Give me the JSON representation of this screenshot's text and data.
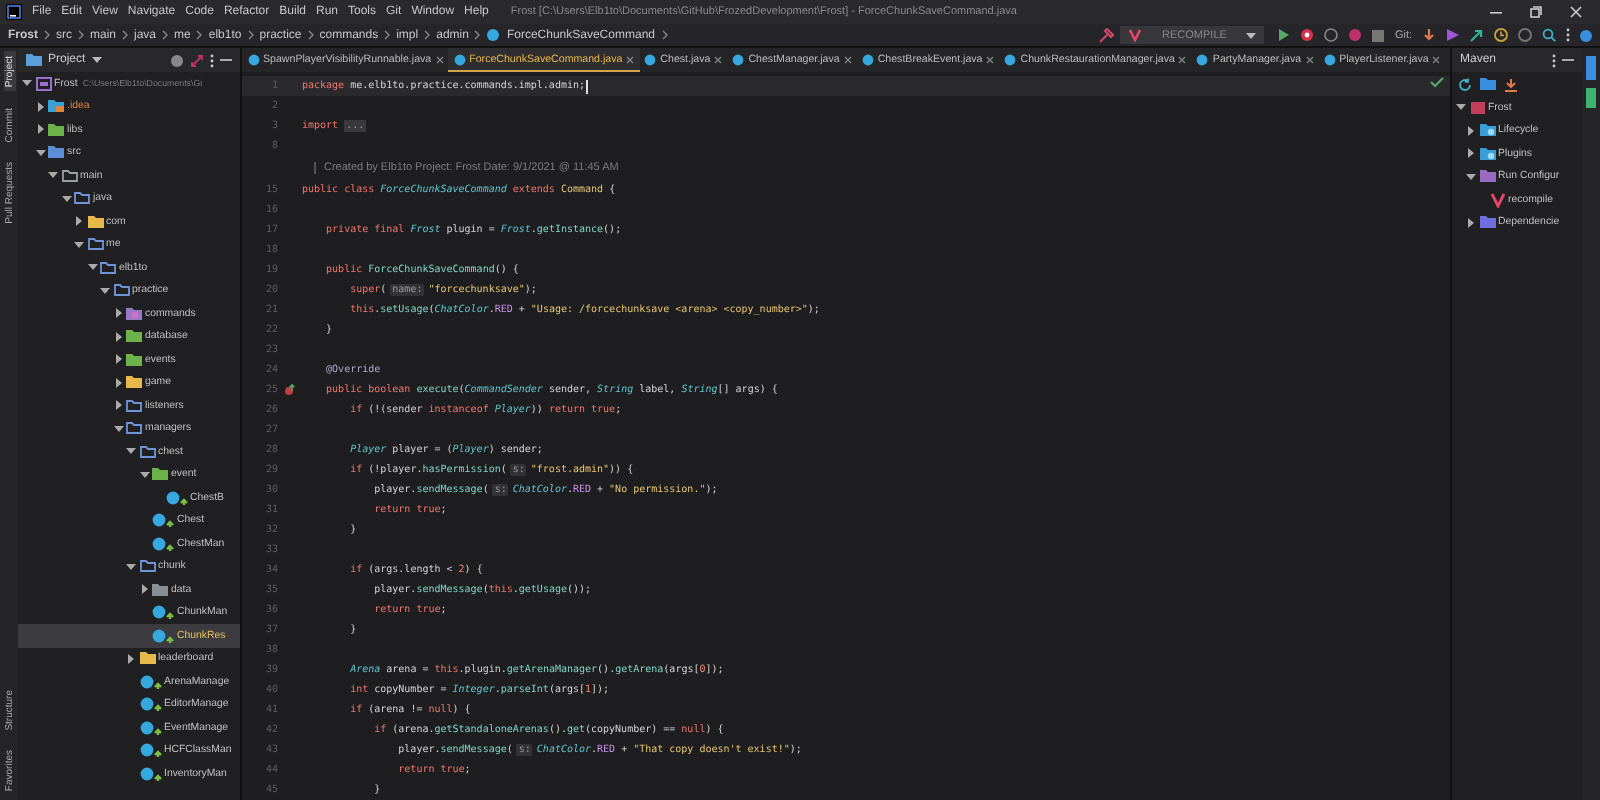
{
  "window": {
    "title": "Frost [C:\\Users\\Elb1to\\Documents\\GitHub\\FrozedDevelopment\\Frost] - ForceChunkSaveCommand.java",
    "menu": [
      "File",
      "Edit",
      "View",
      "Navigate",
      "Code",
      "Refactor",
      "Build",
      "Run",
      "Tools",
      "Git",
      "Window",
      "Help"
    ]
  },
  "breadcrumb": [
    "Frost",
    "src",
    "main",
    "java",
    "me",
    "elb1to",
    "practice",
    "commands",
    "impl",
    "admin",
    "ForceChunkSaveCommand"
  ],
  "toolbar": {
    "run_configuration": "RECOMPILE",
    "vcs_label": "Git:"
  },
  "left_strip_top": [
    {
      "label": "Project",
      "selected": true
    },
    {
      "label": "Commit",
      "selected": false
    },
    {
      "label": "Pull Requests",
      "selected": false
    }
  ],
  "left_strip_bottom": [
    {
      "label": "Structure",
      "selected": false
    },
    {
      "label": "Favorites",
      "selected": false
    }
  ],
  "project_panel": {
    "title": "Project",
    "tree": [
      {
        "label": "Frost",
        "path": "C:\\Users\\Elb1to\\Documents\\Gi",
        "kind": "module",
        "expanded": true,
        "selected": false,
        "children": [
          {
            "label": ".idea",
            "kind": "excluded",
            "expanded": false,
            "selected": false
          },
          {
            "label": "libs",
            "kind": "library",
            "expanded": false,
            "selected": false
          },
          {
            "label": "src",
            "kind": "source",
            "expanded": true,
            "selected": false,
            "children": [
              {
                "label": "main",
                "kind": "folder-plain",
                "expanded": true,
                "selected": false,
                "children": [
                  {
                    "label": "java",
                    "kind": "package",
                    "expanded": true,
                    "selected": false,
                    "children": [
                      {
                        "label": "com",
                        "kind": "folder",
                        "expanded": false,
                        "selected": false
                      },
                      {
                        "label": "me",
                        "kind": "package",
                        "expanded": true,
                        "selected": false,
                        "children": [
                          {
                            "label": "elb1to",
                            "kind": "package",
                            "expanded": true,
                            "selected": false,
                            "children": [
                              {
                                "label": "practice",
                                "kind": "package",
                                "expanded": true,
                                "selected": false,
                                "children": [
                                  {
                                    "label": "commands",
                                    "kind": "resource",
                                    "expanded": false,
                                    "selected": false
                                  },
                                  {
                                    "label": "database",
                                    "kind": "library",
                                    "expanded": false,
                                    "selected": false
                                  },
                                  {
                                    "label": "events",
                                    "kind": "library",
                                    "expanded": false,
                                    "selected": false
                                  },
                                  {
                                    "label": "game",
                                    "kind": "folder",
                                    "expanded": false,
                                    "selected": false
                                  },
                                  {
                                    "label": "listeners",
                                    "kind": "package",
                                    "expanded": false,
                                    "selected": false
                                  },
                                  {
                                    "label": "managers",
                                    "kind": "package",
                                    "expanded": true,
                                    "selected": false,
                                    "children": [
                                      {
                                        "label": "chest",
                                        "kind": "package",
                                        "expanded": true,
                                        "selected": false,
                                        "children": [
                                          {
                                            "label": "event",
                                            "kind": "library",
                                            "expanded": true,
                                            "selected": false,
                                            "children": [
                                              {
                                                "label": "ChestB",
                                                "kind": "class",
                                                "selected": false
                                              }
                                            ]
                                          },
                                          {
                                            "label": "Chest",
                                            "kind": "class",
                                            "selected": false
                                          },
                                          {
                                            "label": "ChestMan",
                                            "kind": "class",
                                            "selected": false
                                          }
                                        ]
                                      },
                                      {
                                        "label": "chunk",
                                        "kind": "package",
                                        "expanded": true,
                                        "selected": false,
                                        "children": [
                                          {
                                            "label": "data",
                                            "kind": "folder-grey",
                                            "expanded": false,
                                            "selected": false
                                          },
                                          {
                                            "label": "ChunkMan",
                                            "kind": "class",
                                            "selected": false
                                          },
                                          {
                                            "label": "ChunkRes",
                                            "kind": "class",
                                            "selected": true
                                          }
                                        ]
                                      },
                                      {
                                        "label": "leaderboard",
                                        "kind": "folder",
                                        "expanded": false,
                                        "selected": false
                                      },
                                      {
                                        "label": "ArenaManage",
                                        "kind": "class",
                                        "selected": false
                                      },
                                      {
                                        "label": "EditorManage",
                                        "kind": "class",
                                        "selected": false
                                      },
                                      {
                                        "label": "EventManage",
                                        "kind": "class",
                                        "selected": false
                                      },
                                      {
                                        "label": "HCFClassMan",
                                        "kind": "class",
                                        "selected": false
                                      },
                                      {
                                        "label": "InventoryMan",
                                        "kind": "class",
                                        "selected": false
                                      }
                                    ]
                                  }
                                ]
                              }
                            ]
                          }
                        ]
                      }
                    ]
                  }
                ]
              }
            ]
          }
        ]
      }
    ]
  },
  "editor": {
    "tabs": [
      {
        "label": "SpawnPlayerVisibilityRunnable.java",
        "selected": false
      },
      {
        "label": "ForceChunkSaveCommand.java",
        "selected": true
      },
      {
        "label": "Chest.java",
        "selected": false
      },
      {
        "label": "ChestManager.java",
        "selected": false
      },
      {
        "label": "ChestBreakEvent.java",
        "selected": false
      },
      {
        "label": "ChunkRestaurationManager.java",
        "selected": false
      },
      {
        "label": "PartyManager.java",
        "selected": false
      },
      {
        "label": "PlayerListener.java",
        "selected": false
      }
    ],
    "lines": [
      {
        "kind": "code",
        "number": "1",
        "current": true,
        "tokens": [
          {
            "kind": "keyword",
            "text": "package "
          },
          {
            "kind": "plain",
            "text": "me.elb1to.practice.commands.impl.admin;"
          }
        ]
      },
      {
        "kind": "code",
        "number": "2",
        "current": false
      },
      {
        "kind": "code",
        "number": "3",
        "current": false,
        "tokens": [
          {
            "kind": "keyword",
            "text": "import "
          },
          {
            "kind": "fold",
            "text": "..."
          }
        ]
      },
      {
        "kind": "code",
        "number": "8",
        "current": false
      },
      {
        "kind": "doc",
        "current": false,
        "tokens": [
          {
            "kind": "doc",
            "text": "Created by Elb1to Project: Frost Date: 9/1/2021 @ 11:45 AM"
          }
        ]
      },
      {
        "kind": "code",
        "number": "15",
        "current": false,
        "tokens": [
          {
            "kind": "keyword",
            "text": "public class "
          },
          {
            "kind": "type",
            "text": "ForceChunkSaveCommand "
          },
          {
            "kind": "keyword",
            "text": "extends "
          },
          {
            "kind": "super",
            "text": "Command "
          },
          {
            "kind": "plain",
            "text": "{"
          }
        ]
      },
      {
        "kind": "code",
        "number": "16",
        "current": false
      },
      {
        "kind": "code",
        "number": "17",
        "current": false,
        "tokens": [
          {
            "kind": "keyword",
            "text": "    private final "
          },
          {
            "kind": "type",
            "text": "Frost "
          },
          {
            "kind": "plain",
            "text": "plugin = "
          },
          {
            "kind": "type",
            "text": "Frost"
          },
          {
            "kind": "plain",
            "text": "."
          },
          {
            "kind": "method",
            "text": "getInstance"
          },
          {
            "kind": "plain",
            "text": "();"
          }
        ]
      },
      {
        "kind": "code",
        "number": "18",
        "current": false
      },
      {
        "kind": "code",
        "number": "19",
        "current": false,
        "tokens": [
          {
            "kind": "keyword",
            "text": "    public "
          },
          {
            "kind": "method",
            "text": "ForceChunkSaveCommand"
          },
          {
            "kind": "plain",
            "text": "() {"
          }
        ]
      },
      {
        "kind": "code",
        "number": "20",
        "current": false,
        "tokens": [
          {
            "kind": "keyword",
            "text": "        super"
          },
          {
            "kind": "plain",
            "text": "("
          },
          {
            "kind": "hint",
            "text": "name:"
          },
          {
            "kind": "string",
            "text": "\"forcechunksave\""
          },
          {
            "kind": "plain",
            "text": ");"
          }
        ]
      },
      {
        "kind": "code",
        "number": "21",
        "current": false,
        "tokens": [
          {
            "kind": "keyword",
            "text": "        this"
          },
          {
            "kind": "plain",
            "text": "."
          },
          {
            "kind": "method",
            "text": "setUsage"
          },
          {
            "kind": "plain",
            "text": "("
          },
          {
            "kind": "type",
            "text": "ChatColor"
          },
          {
            "kind": "plain",
            "text": "."
          },
          {
            "kind": "field",
            "text": "RED"
          },
          {
            "kind": "plain",
            "text": " + "
          },
          {
            "kind": "string",
            "text": "\"Usage: /forcechunksave <arena> <copy_number>\""
          },
          {
            "kind": "plain",
            "text": ");"
          }
        ]
      },
      {
        "kind": "code",
        "number": "22",
        "current": false,
        "tokens": [
          {
            "kind": "plain",
            "text": "    }"
          }
        ]
      },
      {
        "kind": "code",
        "number": "23",
        "current": false
      },
      {
        "kind": "code",
        "number": "24",
        "current": false,
        "tokens": [
          {
            "kind": "annotation",
            "text": "    @Override"
          }
        ]
      },
      {
        "kind": "override",
        "number": "25",
        "current": false,
        "tokens": [
          {
            "kind": "keyword",
            "text": "    public boolean "
          },
          {
            "kind": "method",
            "text": "execute"
          },
          {
            "kind": "plain",
            "text": "("
          },
          {
            "kind": "type",
            "text": "CommandSender "
          },
          {
            "kind": "plain",
            "text": "sender, "
          },
          {
            "kind": "type",
            "text": "String "
          },
          {
            "kind": "plain",
            "text": "label, "
          },
          {
            "kind": "type",
            "text": "String"
          },
          {
            "kind": "plain",
            "text": "[] args) {"
          }
        ]
      },
      {
        "kind": "code",
        "number": "26",
        "current": false,
        "tokens": [
          {
            "kind": "keyword",
            "text": "        if "
          },
          {
            "kind": "plain",
            "text": "(!(sender "
          },
          {
            "kind": "keyword",
            "text": "instanceof "
          },
          {
            "kind": "type",
            "text": "Player"
          },
          {
            "kind": "plain",
            "text": ")) "
          },
          {
            "kind": "keyword",
            "text": "return true"
          },
          {
            "kind": "plain",
            "text": ";"
          }
        ]
      },
      {
        "kind": "code",
        "number": "27",
        "current": false
      },
      {
        "kind": "code",
        "number": "28",
        "current": false,
        "tokens": [
          {
            "kind": "type",
            "text": "        Player "
          },
          {
            "kind": "plain",
            "text": "player = ("
          },
          {
            "kind": "type",
            "text": "Player"
          },
          {
            "kind": "plain",
            "text": ") sender;"
          }
        ]
      },
      {
        "kind": "code",
        "number": "29",
        "current": false,
        "tokens": [
          {
            "kind": "keyword",
            "text": "        if "
          },
          {
            "kind": "plain",
            "text": "(!player."
          },
          {
            "kind": "method",
            "text": "hasPermission"
          },
          {
            "kind": "plain",
            "text": "("
          },
          {
            "kind": "hint",
            "text": "s:"
          },
          {
            "kind": "string",
            "text": "\"frost.admin\""
          },
          {
            "kind": "plain",
            "text": ")) {"
          }
        ]
      },
      {
        "kind": "code",
        "number": "30",
        "current": false,
        "tokens": [
          {
            "kind": "plain",
            "text": "            player."
          },
          {
            "kind": "method",
            "text": "sendMessage"
          },
          {
            "kind": "plain",
            "text": "("
          },
          {
            "kind": "hint",
            "text": "s:"
          },
          {
            "kind": "type",
            "text": "ChatColor"
          },
          {
            "kind": "plain",
            "text": "."
          },
          {
            "kind": "field",
            "text": "RED"
          },
          {
            "kind": "plain",
            "text": " + "
          },
          {
            "kind": "string",
            "text": "\"No permission.\""
          },
          {
            "kind": "plain",
            "text": ");"
          }
        ]
      },
      {
        "kind": "code",
        "number": "31",
        "current": false,
        "tokens": [
          {
            "kind": "keyword",
            "text": "            return true"
          },
          {
            "kind": "plain",
            "text": ";"
          }
        ]
      },
      {
        "kind": "code",
        "number": "32",
        "current": false,
        "tokens": [
          {
            "kind": "plain",
            "text": "        }"
          }
        ]
      },
      {
        "kind": "code",
        "number": "33",
        "current": false
      },
      {
        "kind": "code",
        "number": "34",
        "current": false,
        "tokens": [
          {
            "kind": "keyword",
            "text": "        if "
          },
          {
            "kind": "plain",
            "text": "(args.length < "
          },
          {
            "kind": "number",
            "text": "2"
          },
          {
            "kind": "plain",
            "text": ") {"
          }
        ]
      },
      {
        "kind": "code",
        "number": "35",
        "current": false,
        "tokens": [
          {
            "kind": "plain",
            "text": "            player."
          },
          {
            "kind": "method",
            "text": "sendMessage"
          },
          {
            "kind": "plain",
            "text": "("
          },
          {
            "kind": "keyword",
            "text": "this"
          },
          {
            "kind": "plain",
            "text": "."
          },
          {
            "kind": "method",
            "text": "getUsage"
          },
          {
            "kind": "plain",
            "text": "());"
          }
        ]
      },
      {
        "kind": "code",
        "number": "36",
        "current": false,
        "tokens": [
          {
            "kind": "keyword",
            "text": "            return true"
          },
          {
            "kind": "plain",
            "text": ";"
          }
        ]
      },
      {
        "kind": "code",
        "number": "37",
        "current": false,
        "tokens": [
          {
            "kind": "plain",
            "text": "        }"
          }
        ]
      },
      {
        "kind": "code",
        "number": "38",
        "current": false
      },
      {
        "kind": "code",
        "number": "39",
        "current": false,
        "tokens": [
          {
            "kind": "type",
            "text": "        Arena "
          },
          {
            "kind": "plain",
            "text": "arena = "
          },
          {
            "kind": "keyword",
            "text": "this"
          },
          {
            "kind": "plain",
            "text": ".plugin."
          },
          {
            "kind": "method",
            "text": "getArenaManager"
          },
          {
            "kind": "plain",
            "text": "()."
          },
          {
            "kind": "method",
            "text": "getArena"
          },
          {
            "kind": "plain",
            "text": "(args["
          },
          {
            "kind": "number",
            "text": "0"
          },
          {
            "kind": "plain",
            "text": "]);"
          }
        ]
      },
      {
        "kind": "code",
        "number": "40",
        "current": false,
        "tokens": [
          {
            "kind": "keyword",
            "text": "        int "
          },
          {
            "kind": "plain",
            "text": "copyNumber = "
          },
          {
            "kind": "type",
            "text": "Integer"
          },
          {
            "kind": "plain",
            "text": "."
          },
          {
            "kind": "method",
            "text": "parseInt"
          },
          {
            "kind": "plain",
            "text": "(args["
          },
          {
            "kind": "number",
            "text": "1"
          },
          {
            "kind": "plain",
            "text": "]);"
          }
        ]
      },
      {
        "kind": "code",
        "number": "41",
        "current": false,
        "tokens": [
          {
            "kind": "keyword",
            "text": "        if "
          },
          {
            "kind": "plain",
            "text": "(arena != "
          },
          {
            "kind": "keyword",
            "text": "null"
          },
          {
            "kind": "plain",
            "text": ") {"
          }
        ]
      },
      {
        "kind": "code",
        "number": "42",
        "current": false,
        "tokens": [
          {
            "kind": "keyword",
            "text": "            if "
          },
          {
            "kind": "plain",
            "text": "(arena."
          },
          {
            "kind": "method",
            "text": "getStandaloneArenas"
          },
          {
            "kind": "plain",
            "text": "()."
          },
          {
            "kind": "method",
            "text": "get"
          },
          {
            "kind": "plain",
            "text": "(copyNumber) == "
          },
          {
            "kind": "keyword",
            "text": "null"
          },
          {
            "kind": "plain",
            "text": ") {"
          }
        ]
      },
      {
        "kind": "code",
        "number": "43",
        "current": false,
        "tokens": [
          {
            "kind": "plain",
            "text": "                player."
          },
          {
            "kind": "method",
            "text": "sendMessage"
          },
          {
            "kind": "plain",
            "text": "("
          },
          {
            "kind": "hint",
            "text": "s:"
          },
          {
            "kind": "type",
            "text": "ChatColor"
          },
          {
            "kind": "plain",
            "text": "."
          },
          {
            "kind": "field",
            "text": "RED"
          },
          {
            "kind": "plain",
            "text": " + "
          },
          {
            "kind": "string",
            "text": "\"That copy doesn't exist!\""
          },
          {
            "kind": "plain",
            "text": ");"
          }
        ]
      },
      {
        "kind": "code",
        "number": "44",
        "current": false,
        "tokens": [
          {
            "kind": "keyword",
            "text": "                return true"
          },
          {
            "kind": "plain",
            "text": ";"
          }
        ]
      },
      {
        "kind": "code",
        "number": "45",
        "current": false,
        "tokens": [
          {
            "kind": "plain",
            "text": "            }"
          }
        ]
      }
    ]
  },
  "maven_panel": {
    "title": "Maven",
    "tree": [
      {
        "label": "Frost",
        "kind": "maven-project",
        "expanded": true,
        "selected": false,
        "children": [
          {
            "label": "Lifecycle",
            "kind": "maven-group",
            "expanded": false,
            "selected": false
          },
          {
            "label": "Plugins",
            "kind": "maven-group",
            "expanded": false,
            "selected": false
          },
          {
            "label": "Run Configur",
            "kind": "run-group",
            "expanded": true,
            "selected": false,
            "children": [
              {
                "label": "recompile",
                "kind": "run-config",
                "selected": false
              }
            ]
          },
          {
            "label": "Dependencie",
            "kind": "dependencies",
            "expanded": false,
            "selected": false
          }
        ]
      }
    ]
  }
}
